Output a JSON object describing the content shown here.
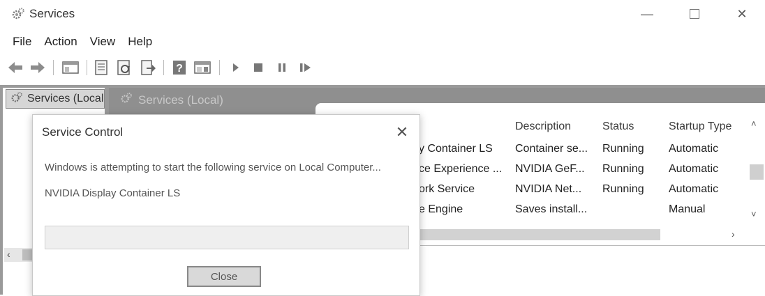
{
  "window": {
    "title": "Services",
    "minimize_symbol": "—",
    "close_symbol": "✕"
  },
  "menu": [
    "File",
    "Action",
    "View",
    "Help"
  ],
  "tree": {
    "root_label": "Services (Local"
  },
  "right_pane": {
    "title": "Services (Local)"
  },
  "table": {
    "columns": [
      "Description",
      "Status",
      "Startup Type"
    ],
    "rows": [
      {
        "name": "y Container LS",
        "description": "Container se...",
        "status": "Running",
        "startup": "Automatic"
      },
      {
        "name": "ce Experience ...",
        "description": "NVIDIA GeF...",
        "status": "Running",
        "startup": "Automatic"
      },
      {
        "name": "ork Service",
        "description": "NVIDIA Net...",
        "status": "Running",
        "startup": "Automatic"
      },
      {
        "name": "e Engine",
        "description": "Saves install...",
        "status": "",
        "startup": "Manual"
      }
    ]
  },
  "dialog": {
    "title": "Service Control",
    "close_symbol": "✕",
    "message": "Windows is attempting to start the following service on Local Computer...",
    "service_name": "NVIDIA Display Container LS",
    "button_label": "Close",
    "progress": 0
  },
  "icons": {
    "back": "arrow-left-icon",
    "forward": "arrow-right-icon",
    "show_hide_tree": "console-tree-icon",
    "properties": "properties-icon",
    "refresh": "refresh-icon",
    "export": "export-list-icon",
    "help": "help-icon",
    "action_pane": "action-pane-icon",
    "start": "play-icon",
    "stop": "stop-icon",
    "pause": "pause-icon",
    "restart": "restart-icon"
  }
}
